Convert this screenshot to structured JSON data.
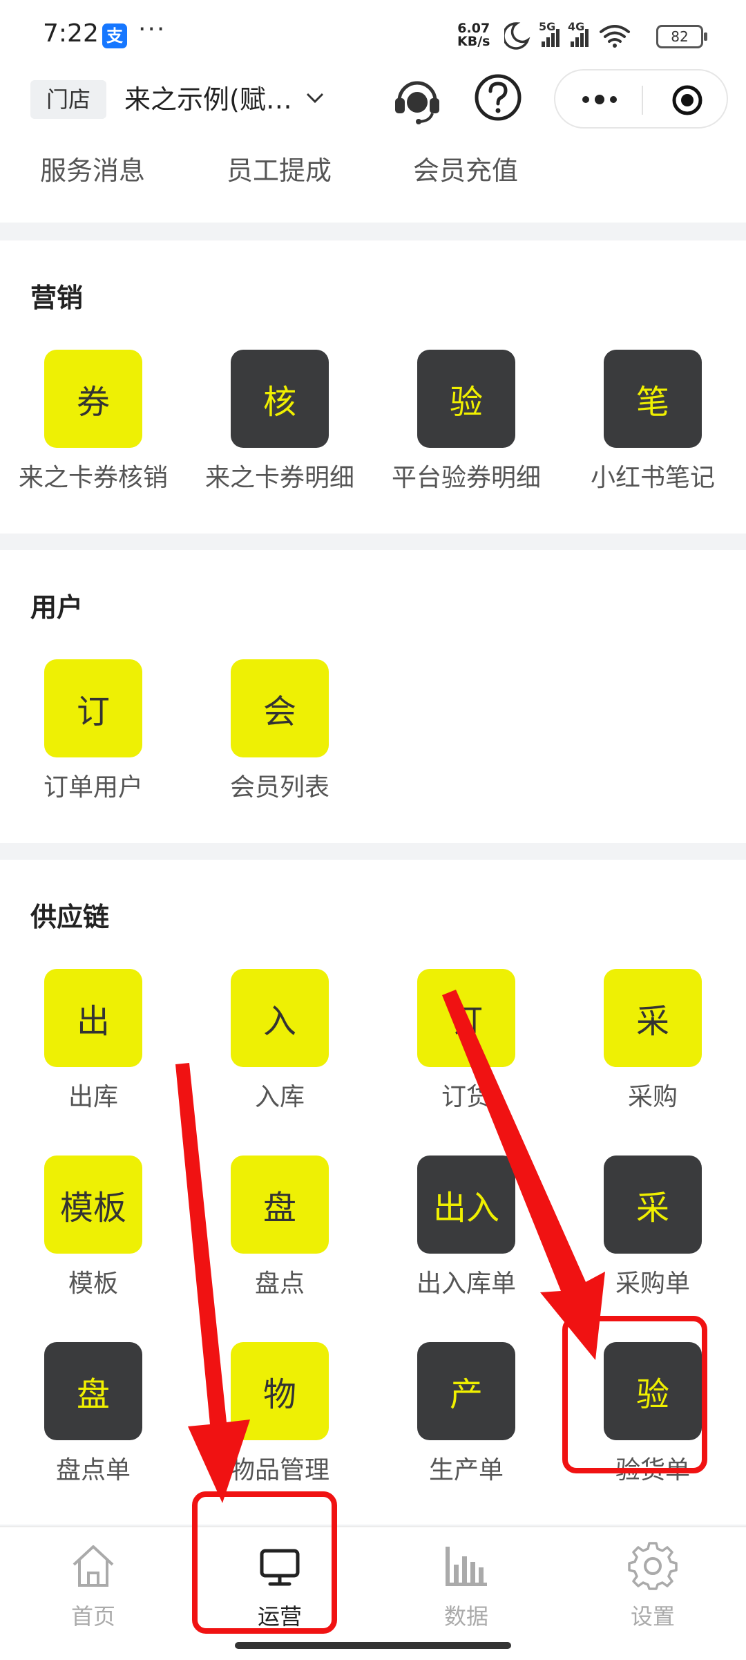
{
  "status_bar": {
    "time": "7:22",
    "alipay_glyph": "支",
    "more": "···",
    "net_speed_value": "6.07",
    "net_speed_unit": "KB/s",
    "signal_5g": "5G",
    "signal_4g": "4G",
    "battery": "82"
  },
  "header": {
    "store_tag": "门店",
    "store_name": "来之示例(赋…",
    "more_dots": "•••"
  },
  "quick_links": [
    "服务消息",
    "员工提成",
    "会员充值"
  ],
  "sections": {
    "marketing": {
      "title": "营销",
      "items": [
        {
          "glyph": "券",
          "label": "来之卡券核销",
          "style": "yellow"
        },
        {
          "glyph": "核",
          "label": "来之卡券明细",
          "style": "dark"
        },
        {
          "glyph": "验",
          "label": "平台验券明细",
          "style": "dark"
        },
        {
          "glyph": "笔",
          "label": "小红书笔记",
          "style": "dark"
        }
      ]
    },
    "users": {
      "title": "用户",
      "items": [
        {
          "glyph": "订",
          "label": "订单用户",
          "style": "yellow"
        },
        {
          "glyph": "会",
          "label": "会员列表",
          "style": "yellow"
        }
      ]
    },
    "supply": {
      "title": "供应链",
      "items": [
        {
          "glyph": "出",
          "label": "出库",
          "style": "yellow"
        },
        {
          "glyph": "入",
          "label": "入库",
          "style": "yellow"
        },
        {
          "glyph": "订",
          "label": "订货",
          "style": "yellow"
        },
        {
          "glyph": "采",
          "label": "采购",
          "style": "yellow"
        },
        {
          "glyph": "模板",
          "label": "模板",
          "style": "yellow"
        },
        {
          "glyph": "盘",
          "label": "盘点",
          "style": "yellow"
        },
        {
          "glyph": "出入",
          "label": "出入库单",
          "style": "dark"
        },
        {
          "glyph": "采",
          "label": "采购单",
          "style": "dark"
        },
        {
          "glyph": "盘",
          "label": "盘点单",
          "style": "dark"
        },
        {
          "glyph": "物",
          "label": "物品管理",
          "style": "yellow"
        },
        {
          "glyph": "产",
          "label": "生产单",
          "style": "dark"
        },
        {
          "glyph": "验",
          "label": "验货单",
          "style": "dark"
        }
      ]
    }
  },
  "nav": {
    "home": "首页",
    "operations": "运营",
    "data": "数据",
    "settings": "设置"
  },
  "colors": {
    "accent_yellow": "#eef004",
    "dark_tile": "#3a3b3d",
    "annotation_red": "#f01212"
  }
}
